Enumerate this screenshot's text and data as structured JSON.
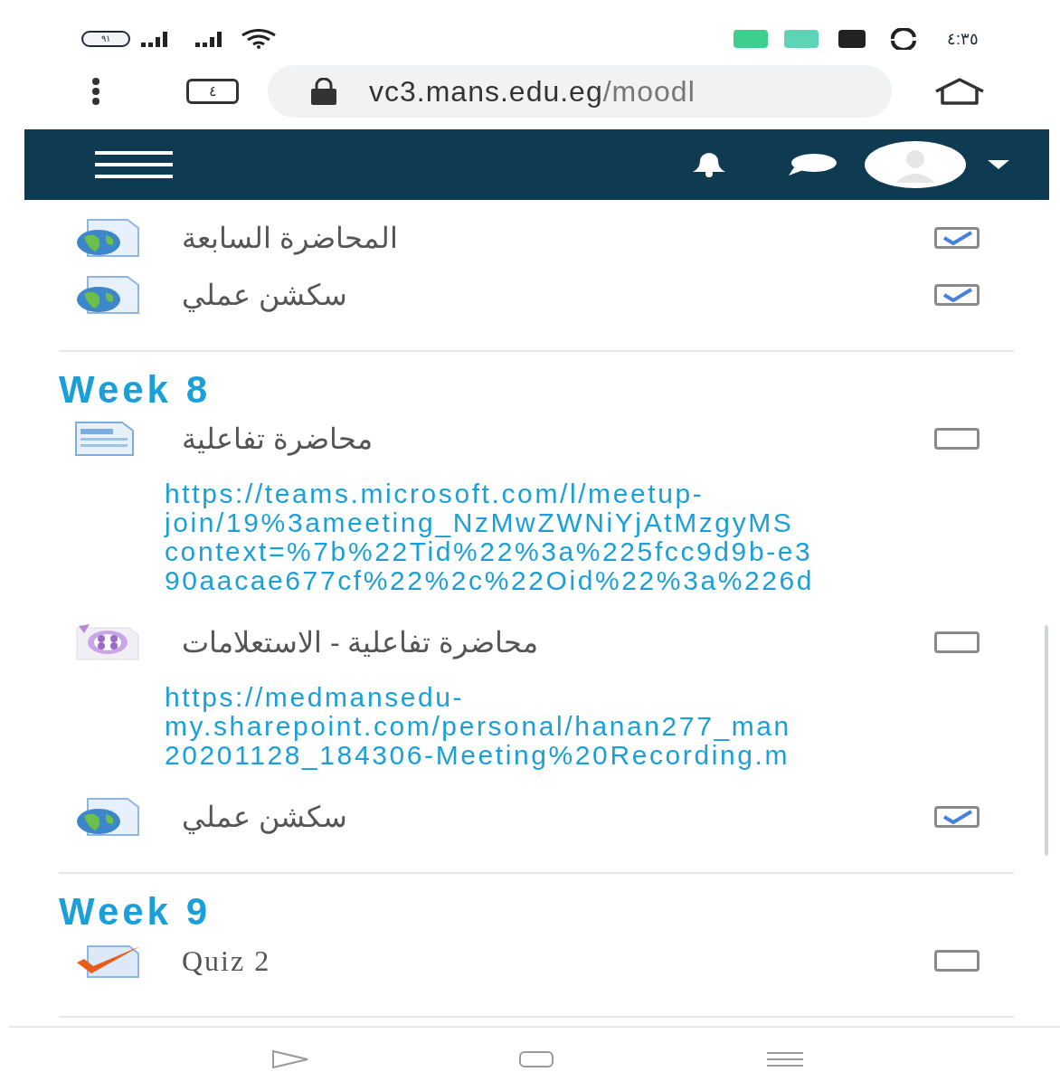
{
  "status_bar": {
    "battery": "٩١",
    "time": "٤:٣٥"
  },
  "browser": {
    "tab_count": "٤",
    "url_host": "vc3.mans.edu.eg",
    "url_path": "/moodl"
  },
  "sections": [
    {
      "activities": [
        {
          "kind": "url",
          "title": "المحاضرة السابعة",
          "checked": true
        },
        {
          "kind": "url",
          "title": "سكشن عملي",
          "checked": true
        }
      ]
    },
    {
      "title": "Week 8",
      "activities": [
        {
          "kind": "page",
          "title": "محاضرة تفاعلية",
          "checked": false,
          "link_lines": [
            "https://teams.microsoft.com/l/meetup-",
            "join/19%3ameeting_NzMwZWNiYjAtMzgyMS",
            "context=%7b%22Tid%22%3a%225fcc9d9b-e3",
            "90aacae677cf%22%2c%22Oid%22%3a%226d"
          ]
        },
        {
          "kind": "video",
          "title": "محاضرة تفاعلية - الاستعلامات",
          "checked": false,
          "link_lines": [
            "https://medmansedu-",
            "my.sharepoint.com/personal/hanan277_man",
            "20201128_184306-Meeting%20Recording.m"
          ]
        },
        {
          "kind": "url",
          "title": "سكشن عملي",
          "checked": true
        }
      ]
    },
    {
      "title": "Week 9",
      "activities": [
        {
          "kind": "quiz",
          "title": "Quiz 2",
          "checked": false
        }
      ]
    }
  ]
}
